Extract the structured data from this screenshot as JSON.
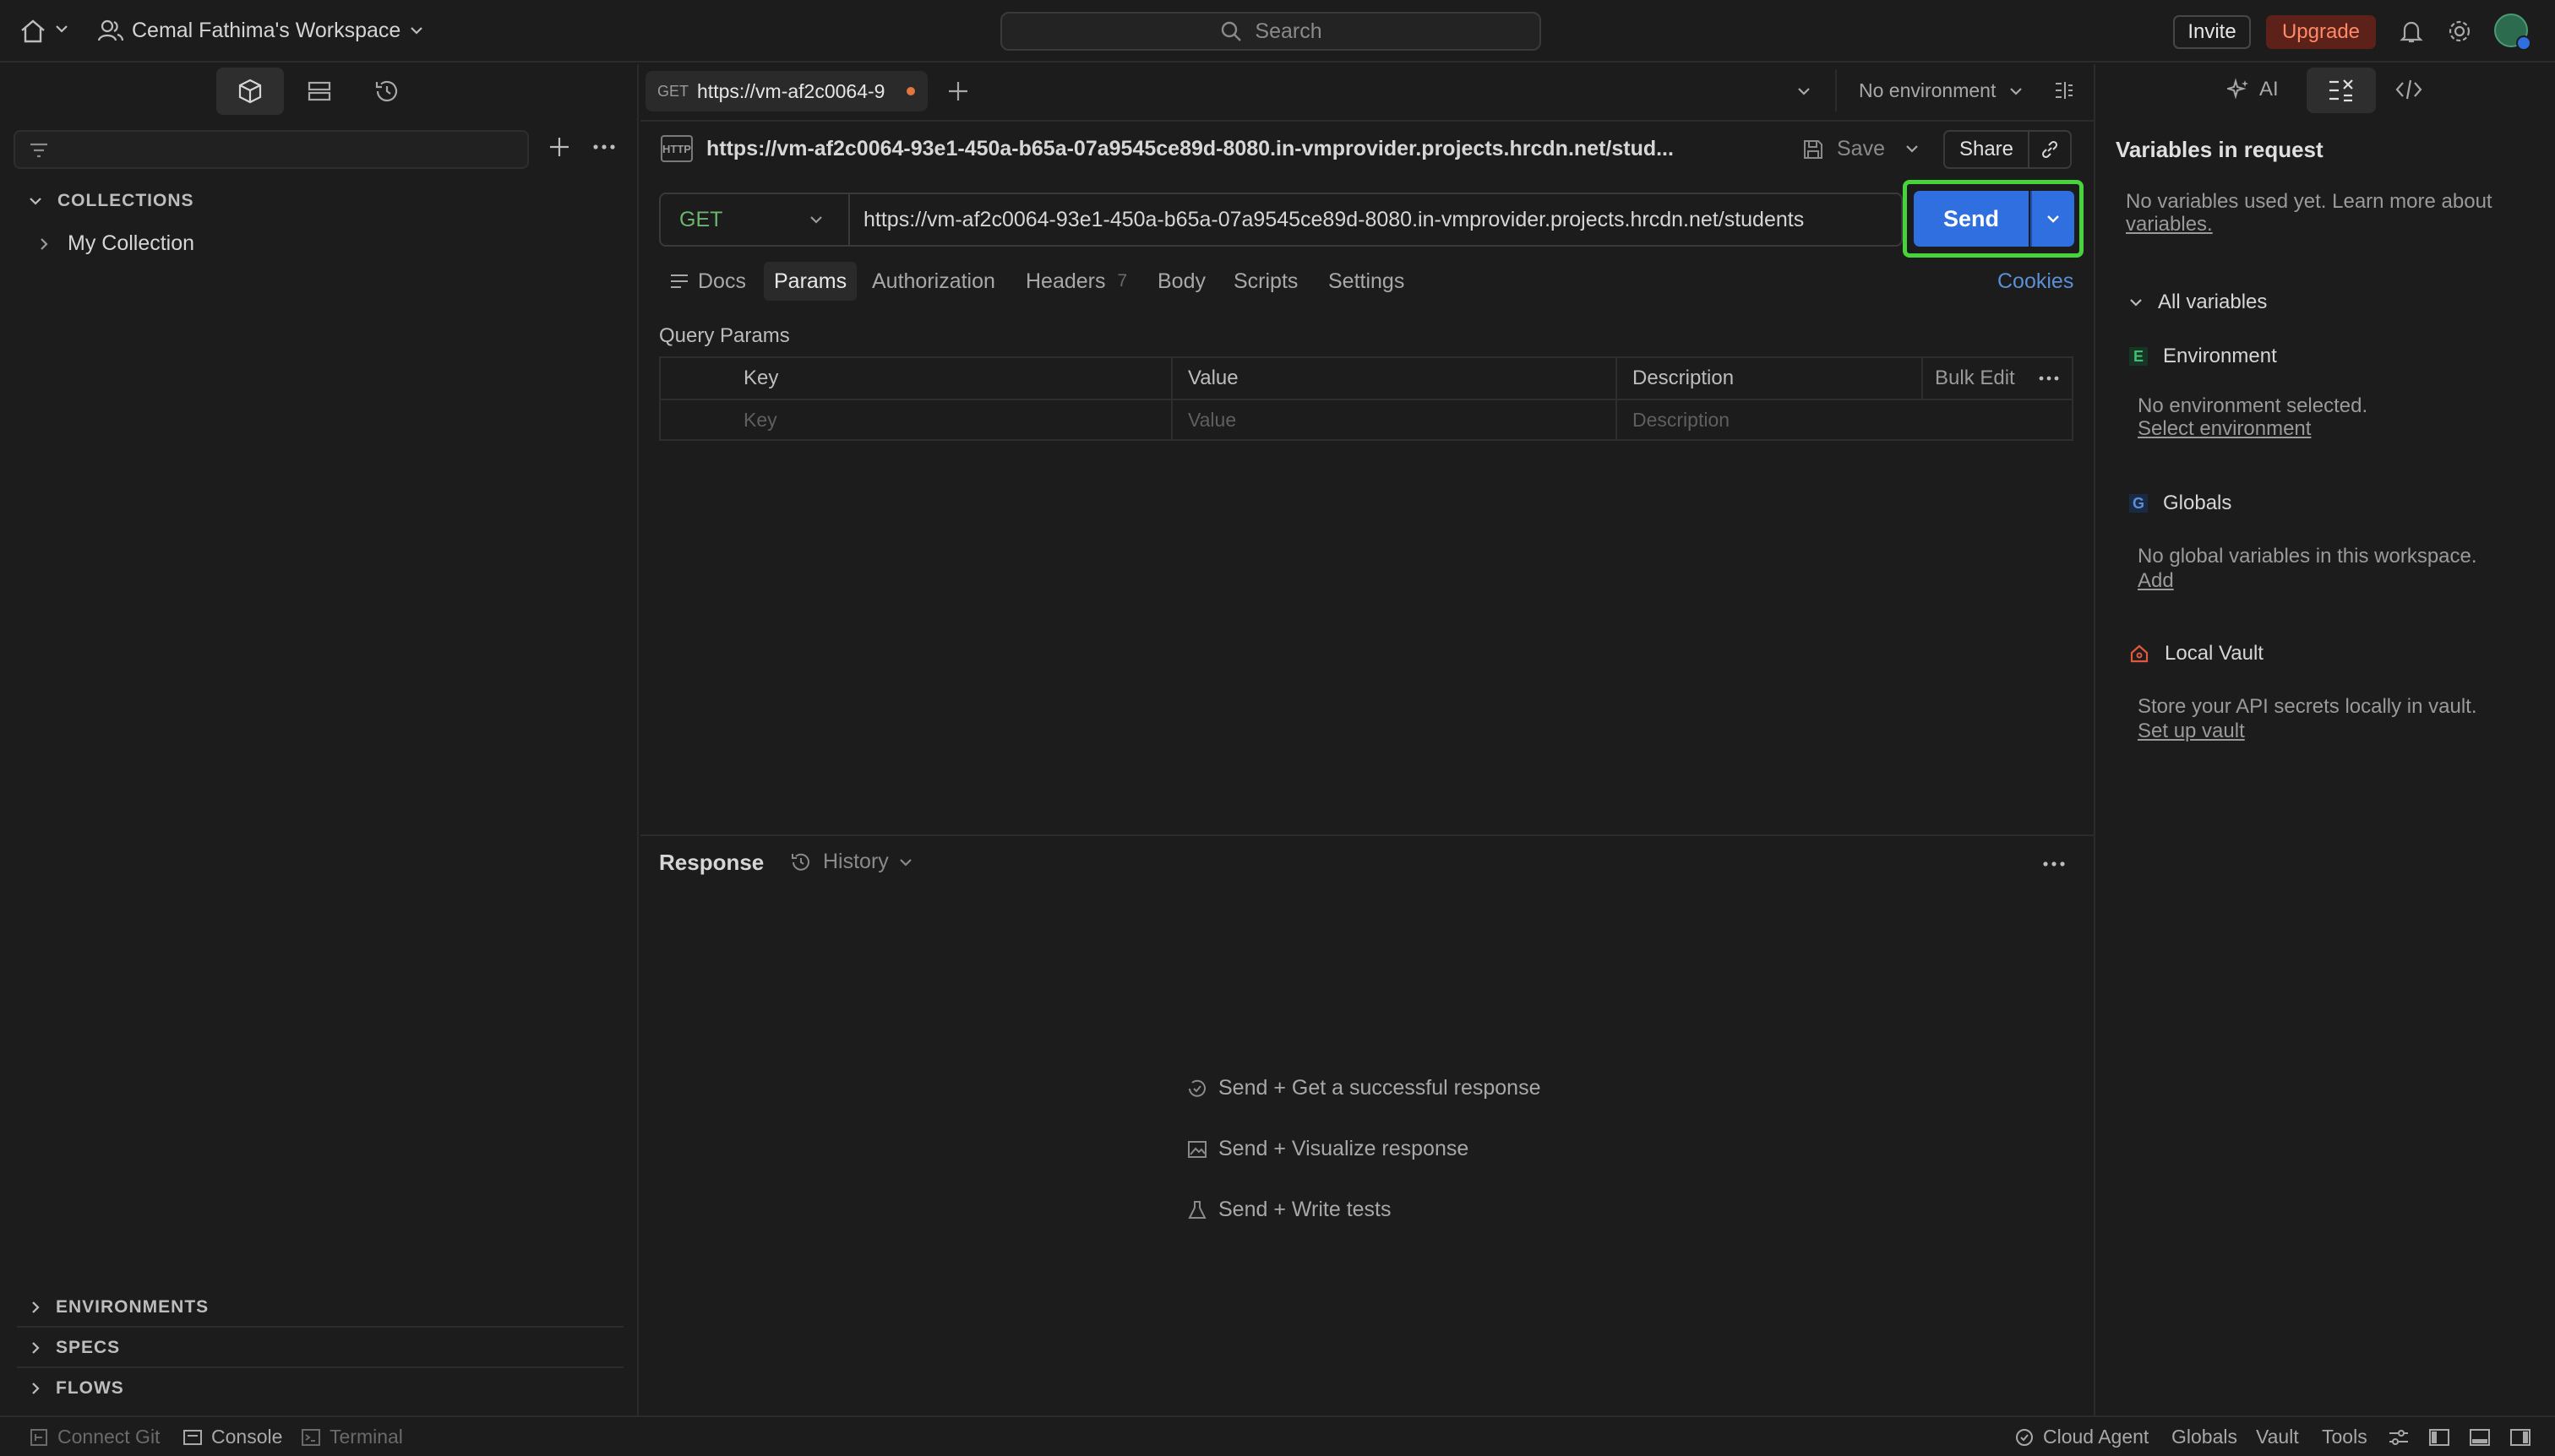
{
  "topbar": {
    "workspace_name": "Cemal Fathima's Workspace",
    "search_placeholder": "Search",
    "invite_label": "Invite",
    "upgrade_label": "Upgrade"
  },
  "tab": {
    "method": "GET",
    "title": "https://vm-af2c0064-9",
    "environment": "No environment"
  },
  "sidebar": {
    "collections_heading": "COLLECTIONS",
    "collection_item": "My Collection",
    "environments_heading": "ENVIRONMENTS",
    "specs_heading": "SPECS",
    "flows_heading": "FLOWS"
  },
  "request": {
    "http_badge": "HTTP",
    "name": "https://vm-af2c0064-93e1-450a-b65a-07a9545ce89d-8080.in-vmprovider.projects.hrcdn.net/stud...",
    "save_label": "Save",
    "share_label": "Share",
    "method": "GET",
    "url": "https://vm-af2c0064-93e1-450a-b65a-07a9545ce89d-8080.in-vmprovider.projects.hrcdn.net/students",
    "send_label": "Send",
    "tabs": {
      "docs": "Docs",
      "params": "Params",
      "authorization": "Authorization",
      "headers": "Headers",
      "headers_count": "7",
      "body": "Body",
      "scripts": "Scripts",
      "settings": "Settings",
      "cookies": "Cookies"
    },
    "query_params": {
      "title": "Query Params",
      "columns": [
        "Key",
        "Value",
        "Description"
      ],
      "bulk_edit": "Bulk Edit",
      "placeholders": [
        "Key",
        "Value",
        "Description"
      ]
    }
  },
  "response": {
    "title": "Response",
    "history_label": "History",
    "hints": [
      "Send + Get a successful response",
      "Send + Visualize response",
      "Send + Write tests"
    ]
  },
  "right_panel": {
    "ai_label": "AI",
    "title": "Variables in request",
    "no_vars_text": "No variables used yet. Learn more about",
    "no_vars_link": "variables.",
    "all_variables": "All variables",
    "environment": {
      "badge": "E",
      "label": "Environment",
      "text": "No environment selected.",
      "link": "Select environment"
    },
    "globals": {
      "badge": "G",
      "label": "Globals",
      "text": "No global variables in this workspace.",
      "link": "Add"
    },
    "vault": {
      "label": "Local Vault",
      "text": "Store your API secrets locally in vault.",
      "link": "Set up vault"
    }
  },
  "statusbar": {
    "connect_git": "Connect Git",
    "console": "Console",
    "terminal": "Terminal",
    "cloud_agent": "Cloud Agent",
    "globals": "Globals",
    "vault": "Vault",
    "tools": "Tools"
  },
  "colors": {
    "send_button": "#2f6fe0",
    "highlight": "#47d43a",
    "method_get": "#6db56d",
    "upgrade": "#ff8a6a"
  }
}
